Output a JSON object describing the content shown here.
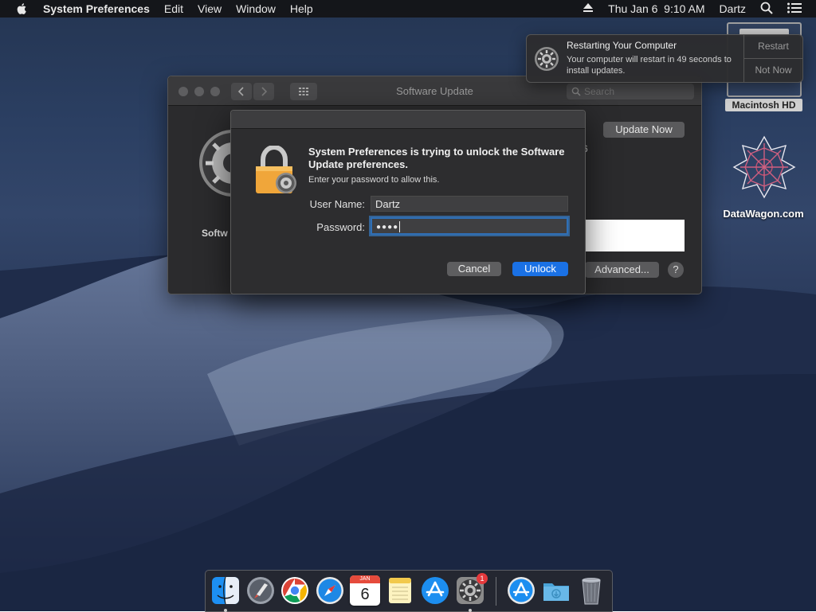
{
  "menubar": {
    "app_name": "System Preferences",
    "menus": [
      "Edit",
      "View",
      "Window",
      "Help"
    ],
    "datetime": "Thu Jan 6  9:10 AM",
    "user": "Dartz"
  },
  "window": {
    "title": "Software Update",
    "search_placeholder": "Search",
    "update_now_label": "Update Now",
    "sidebar_label_partial": "Softw",
    "fragment_text": "6",
    "advanced_label": "Advanced...",
    "help_label": "?"
  },
  "auth_dialog": {
    "heading": "System Preferences is trying to unlock the Software Update preferences.",
    "subtitle": "Enter your password to allow this.",
    "username_label": "User Name:",
    "username_value": "Dartz",
    "password_label": "Password:",
    "password_value": "●●●●",
    "cancel_label": "Cancel",
    "unlock_label": "Unlock"
  },
  "notification": {
    "title": "Restarting Your Computer",
    "body": "Your computer will restart in 49 seconds to install updates.",
    "restart_label": "Restart",
    "not_now_label": "Not Now"
  },
  "desktop": {
    "hd_label": "Macintosh HD",
    "datawagon_label": "DataWagon.com"
  },
  "dock": {
    "items": [
      "finder-icon",
      "launchpad-icon",
      "chrome-icon",
      "safari-icon",
      "calendar-icon",
      "notes-icon",
      "app-store-icon",
      "system-preferences-icon",
      "downloads-icon",
      "folder-icon",
      "trash-icon"
    ],
    "calendar_month": "JAN",
    "calendar_day": "6",
    "sysprefs_badge": "1"
  },
  "colors": {
    "accent": "#1a71e5",
    "badge": "#e5383b"
  }
}
